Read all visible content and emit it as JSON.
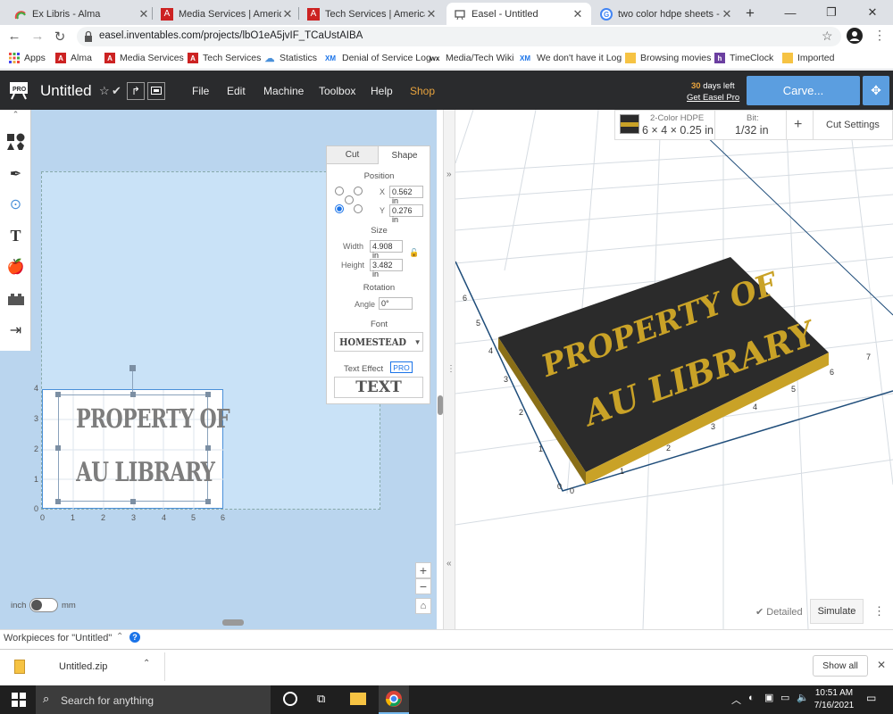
{
  "browser": {
    "tabs": [
      {
        "title": "Ex Libris - Alma",
        "active": false
      },
      {
        "title": "Media Services | American U",
        "active": false
      },
      {
        "title": "Tech Services | American Ur",
        "active": false
      },
      {
        "title": "Easel - Untitled",
        "active": true
      },
      {
        "title": "two color hdpe sheets - Go",
        "active": false
      }
    ],
    "new_tab": "+",
    "url": "easel.inventables.com/projects/lbO1eA5jvIF_TCaUstAIBA",
    "bookmarks": [
      "Apps",
      "Alma",
      "Media Services",
      "Tech Services",
      "Statistics",
      "Denial of Service Log",
      "Media/Tech Wiki",
      "We don't have it Log",
      "Browsing movies",
      "TimeClock",
      "Imported"
    ]
  },
  "easel": {
    "project_title": "Untitled",
    "menu": [
      "File",
      "Edit",
      "Machine",
      "Toolbox",
      "Help",
      "Shop"
    ],
    "trial_days": "30",
    "trial_text": "days left",
    "trial_link": "Get Easel Pro",
    "carve_label": "Carve...",
    "pro_badge": "PRO"
  },
  "material": {
    "name": "2-Color HDPE",
    "dims": "6 × 4 × 0.25 in",
    "bit_label": "Bit:",
    "bit_value": "1/32 in",
    "add": "+",
    "cut_settings": "Cut Settings"
  },
  "design": {
    "text_line1": "PROPERTY OF",
    "text_line2": "AU LIBRARY",
    "x_ticks": [
      "0",
      "1",
      "2",
      "3",
      "4",
      "5",
      "6"
    ],
    "y_ticks": [
      "0",
      "1",
      "2",
      "3",
      "4"
    ],
    "unit_inch": "inch",
    "unit_mm": "mm"
  },
  "shape_panel": {
    "tab_cut": "Cut",
    "tab_shape": "Shape",
    "position_label": "Position",
    "x_label": "X",
    "x_value": "0.562 in",
    "y_label": "Y",
    "y_value": "0.276 in",
    "size_label": "Size",
    "width_label": "Width",
    "width_value": "4.908 in",
    "height_label": "Height",
    "height_value": "3.482 in",
    "rotation_label": "Rotation",
    "angle_label": "Angle",
    "angle_value": "0°",
    "font_label": "Font",
    "font_value": "HOMESTEAD",
    "text_effect_label": "Text Effect",
    "text_effect_badge": "PRO",
    "text_effect_preview": "TEXT"
  },
  "preview": {
    "x_ticks": [
      "0",
      "1",
      "2",
      "3",
      "4",
      "5",
      "6",
      "7"
    ],
    "y_ticks": [
      "0",
      "1",
      "2",
      "3",
      "4",
      "5",
      "6"
    ],
    "detailed_label": "Detailed",
    "simulate_label": "Simulate"
  },
  "footer": {
    "workpieces_label": "Workpieces for \"Untitled\"",
    "download_file": "Untitled.zip",
    "show_all": "Show all"
  },
  "taskbar": {
    "search_placeholder": "Search for anything",
    "time": "10:51 AM",
    "date": "7/16/2021"
  },
  "colors": {
    "easel_header": "#2a2b2d",
    "carve_blue": "#5b9ee0",
    "design_bg": "#bad5ee",
    "shop_orange": "#e8a33d",
    "hdpe_black": "#2b2b2b",
    "hdpe_yellow": "#c9a227"
  }
}
